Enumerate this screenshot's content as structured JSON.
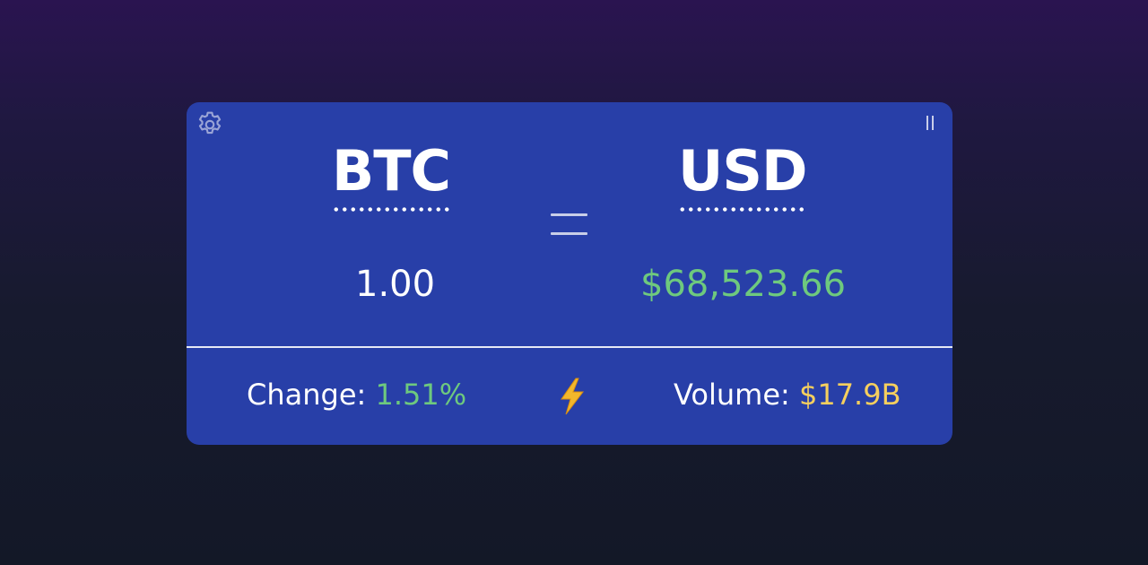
{
  "converter": {
    "from_currency": "BTC",
    "to_currency": "USD",
    "from_amount": "1.00",
    "to_amount": "$68,523.66"
  },
  "stats": {
    "change_label": "Change:",
    "change_value": "1.51%",
    "volume_label": "Volume:",
    "volume_value": "$17.9B"
  },
  "icons": {
    "settings": "gear-icon",
    "pause": "pause-icon",
    "equals": "equals-icon",
    "bolt": "lightning-bolt-icon"
  },
  "colors": {
    "card_background": "#283fa8",
    "positive": "#6ec97e",
    "volume": "#f6cf5e",
    "text": "#ffffff"
  }
}
